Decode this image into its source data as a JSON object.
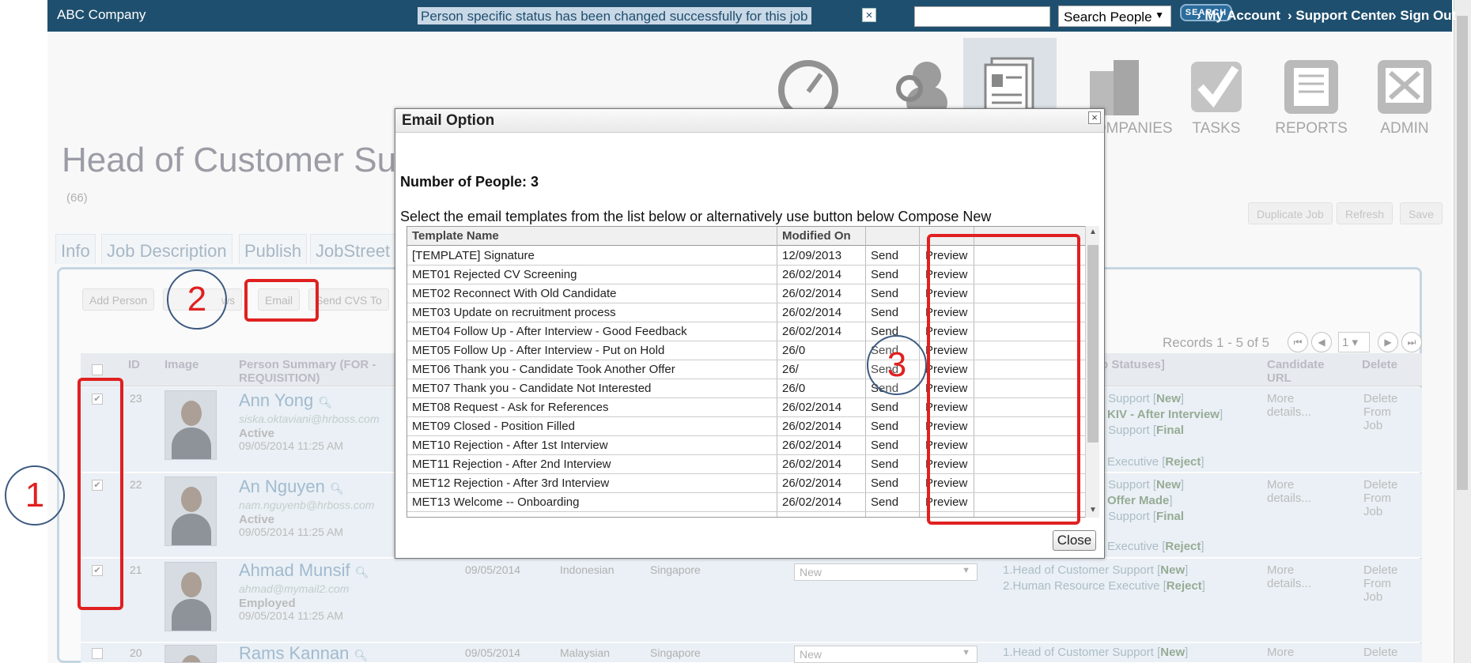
{
  "topbar": {
    "brand": "ABC Company",
    "notice": "Person specific status has been changed successfully for this job",
    "notice_close": "×",
    "search_placeholder": "",
    "search_scope": "Search People",
    "search_button": "SEARCH",
    "links": [
      "› My Account",
      "› Support Center",
      "› Sign Out"
    ]
  },
  "nav": {
    "items": [
      {
        "label": "",
        "icon": "dashboard-icon"
      },
      {
        "label": "",
        "icon": "people-icon"
      },
      {
        "label": "",
        "icon": "jobs-icon"
      },
      {
        "label": "COMPANIES",
        "icon": "companies-icon"
      },
      {
        "label": "TASKS",
        "icon": "tasks-icon"
      },
      {
        "label": "REPORTS",
        "icon": "reports-icon"
      },
      {
        "label": "ADMIN",
        "icon": "admin-icon"
      }
    ]
  },
  "job": {
    "title": "Head of Customer Su",
    "count": "(66)",
    "tabs": [
      "Info",
      "Job Description",
      "Publish",
      "JobStreet"
    ],
    "actions": [
      "Duplicate Job",
      "Refresh",
      "Save"
    ],
    "toolbar": [
      "Add Person",
      "ws",
      "Email",
      "Send CVS To"
    ]
  },
  "grid": {
    "records": "Records 1 - 5 of 5",
    "page": "1",
    "headers": [
      "ID",
      "Image",
      "Person Summary (FOR - REQUISITION)",
      "p Statuses]",
      "Candidate URL",
      "Delete"
    ],
    "rows": [
      {
        "id": "23",
        "name": "Ann Yong",
        "email": "siska.oktaviani@hrboss.com",
        "status": "Active",
        "date": "09/05/2014 11:25 AM",
        "checked": true,
        "stat1": "r Support [",
        "stat1b": "New",
        "stat1c": "]",
        "stat2": "KIV - After Interview",
        "stat3": "r Support [",
        "stat3b": "Final",
        "stat4": "Executive [",
        "stat4b": "Reject",
        "stat4c": "]",
        "more": "More details...",
        "delete": "Delete From Job"
      },
      {
        "id": "22",
        "name": "An Nguyen",
        "email": "nam.nguyenb@hrboss.com",
        "status": "Active",
        "date": "09/05/2014 11:25 AM",
        "checked": true,
        "stat1": "r Support [",
        "stat1b": "New",
        "stat1c": "]",
        "stat2": "Offer Made",
        "stat3": "r Support [",
        "stat3b": "Final",
        "stat4": "Executive [",
        "stat4b": "Reject",
        "stat4c": "]",
        "more": "More details...",
        "delete": "Delete From Job"
      },
      {
        "id": "21",
        "name": "Ahmad Munsif",
        "email": "ahmad@mymail2.com",
        "status": "Employed",
        "date": "09/05/2014 11:25 AM",
        "checked": true,
        "col_date": "09/05/2014",
        "nationality": "Indonesian",
        "location": "Singapore",
        "select": "New",
        "stat1": "1.Head of Customer Support [",
        "stat1b": "New",
        "stat1c": "]",
        "stat2": "2.Human Resource Executive [",
        "stat2b": "Reject",
        "stat2c": "]",
        "more": "More details...",
        "delete": "Delete From Job"
      },
      {
        "id": "20",
        "name": "Rams Kannan",
        "checked": false,
        "col_date": "09/05/2014",
        "nationality": "Malaysian",
        "location": "Singapore",
        "select": "New",
        "stat1": "1.Head of Customer Support [",
        "stat1b": "New",
        "stat1c": "]",
        "more": "More",
        "delete": "Delete"
      }
    ]
  },
  "modal": {
    "title": "Email Option",
    "close_x": "×",
    "num_people": "Number of People: 3",
    "instructions": "Select the email templates from the list below or alternatively use button below Compose New",
    "columns": [
      "Template Name",
      "Modified On"
    ],
    "send_label": "Send",
    "preview_label": "Preview",
    "templates": [
      {
        "name": "[TEMPLATE] Signature",
        "date": "12/09/2013"
      },
      {
        "name": "MET01 Rejected CV Screening",
        "date": "26/02/2014"
      },
      {
        "name": "MET02 Reconnect With Old Candidate",
        "date": "26/02/2014"
      },
      {
        "name": "MET03 Update on recruitment process",
        "date": "26/02/2014"
      },
      {
        "name": "MET04 Follow Up - After Interview - Good Feedback",
        "date": "26/02/2014"
      },
      {
        "name": "MET05 Follow Up - After Interview - Put on Hold",
        "date": "26/0"
      },
      {
        "name": "MET06 Thank you - Candidate Took Another Offer",
        "date": "26/"
      },
      {
        "name": "MET07 Thank you - Candidate Not Interested",
        "date": "26/0"
      },
      {
        "name": "MET08 Request - Ask for References",
        "date": "26/02/2014"
      },
      {
        "name": "MET09 Closed - Position Filled",
        "date": "26/02/2014"
      },
      {
        "name": "MET10 Rejection - After 1st Interview",
        "date": "26/02/2014"
      },
      {
        "name": "MET11 Rejection - After 2nd Interview",
        "date": "26/02/2014"
      },
      {
        "name": "MET12 Rejection - After 3rd Interview",
        "date": "26/02/2014"
      },
      {
        "name": "MET13 Welcome -- Onboarding",
        "date": "26/02/2014"
      }
    ],
    "close_button": "Close"
  },
  "annotations": {
    "callout1": "1",
    "callout2": "2",
    "callout3": "3",
    "color": "#e02020"
  }
}
